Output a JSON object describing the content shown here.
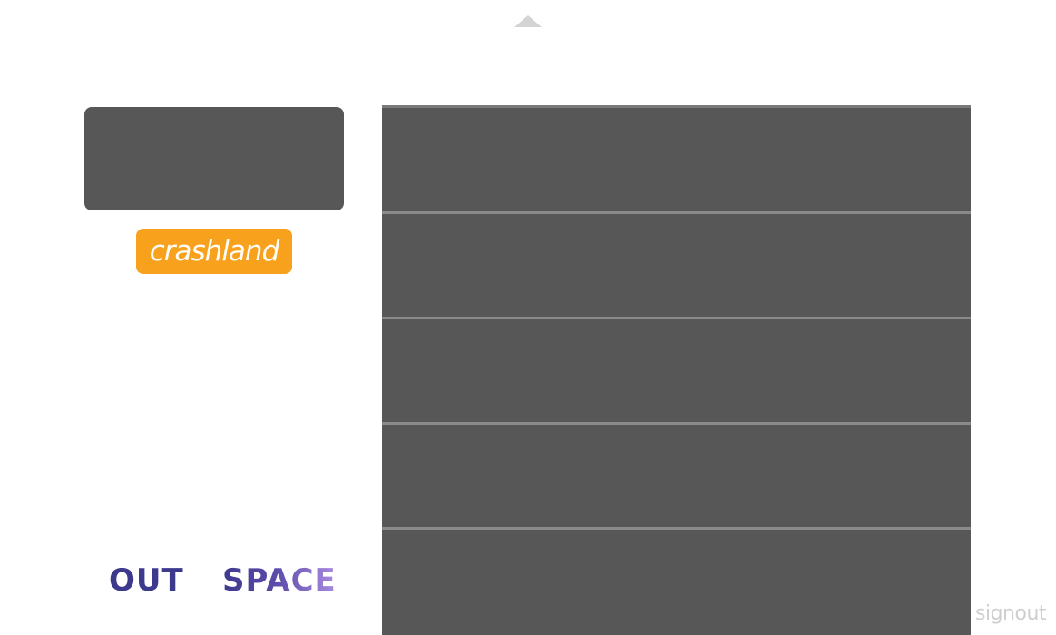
{
  "nav": {
    "scroll_up_icon": "chevron-up-icon"
  },
  "sidebar": {
    "crashland_label": "crashland",
    "out_label": "OUT",
    "space_label": "SPACE"
  },
  "footer": {
    "signout_label": "signout"
  },
  "list": {
    "rows": [
      "",
      "",
      "",
      "",
      ""
    ]
  },
  "colors": {
    "panel": "#575757",
    "divider": "#8a8a8a",
    "accent": "#f7a11d",
    "out_text": "#3d3a8e",
    "signout_text": "#cfcfcf"
  }
}
